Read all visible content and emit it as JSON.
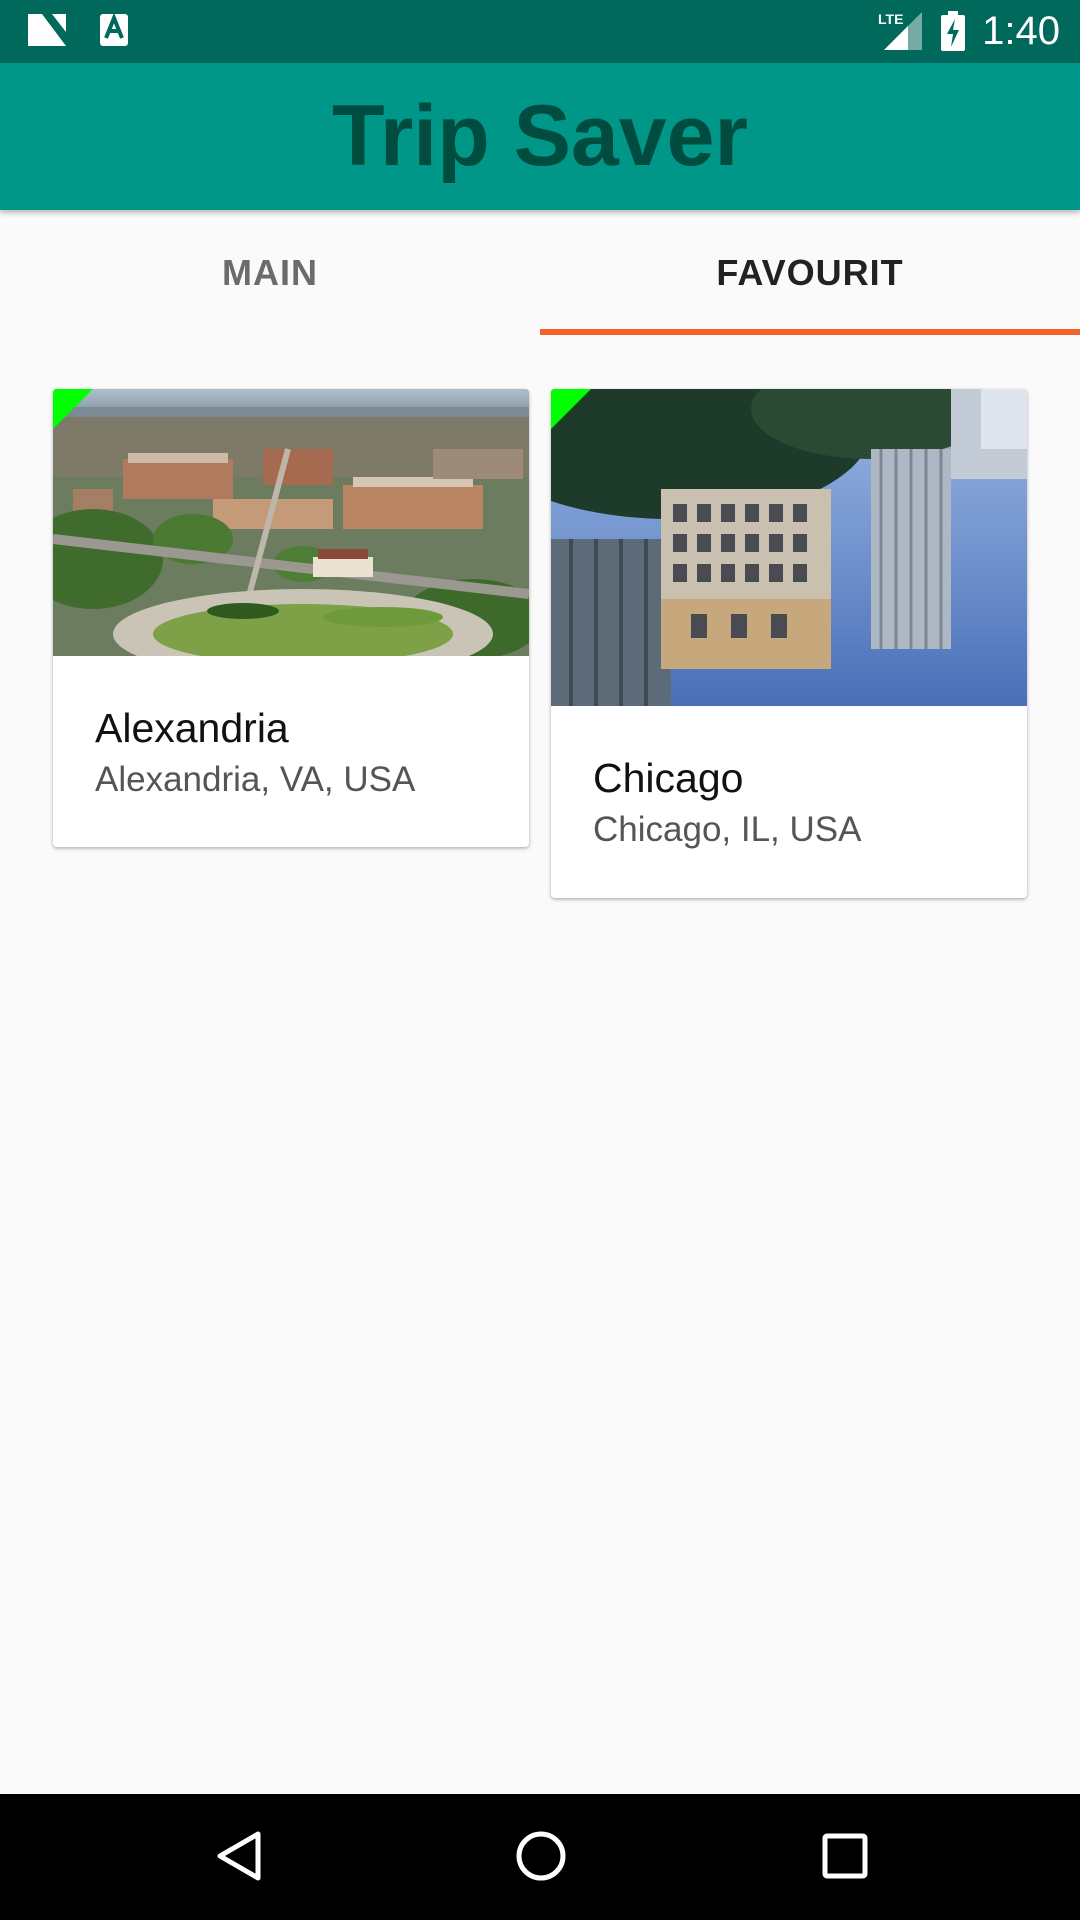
{
  "status_bar": {
    "time": "1:40",
    "network_label": "LTE",
    "icons": [
      "n-notification-icon",
      "a-notification-icon",
      "lte-signal-icon",
      "battery-charging-icon"
    ]
  },
  "app_bar": {
    "title": "Trip Saver",
    "color": "#009688",
    "title_color": "#004d40"
  },
  "tabs": [
    {
      "label": "MAIN",
      "selected": false
    },
    {
      "label": "FAVOURIT",
      "selected": true
    }
  ],
  "accent_color": "#f4622a",
  "cards": [
    {
      "title": "Alexandria",
      "subtitle": "Alexandria, VA, USA",
      "image": "aerial-city-photo",
      "favourite_marker": "#00ff00"
    },
    {
      "title": "Chicago",
      "subtitle": "Chicago, IL, USA",
      "image": "skyscraper-reflection-photo",
      "favourite_marker": "#00ff00"
    }
  ],
  "nav_bar": {
    "icons": [
      "back-icon",
      "home-icon",
      "recents-icon"
    ]
  }
}
